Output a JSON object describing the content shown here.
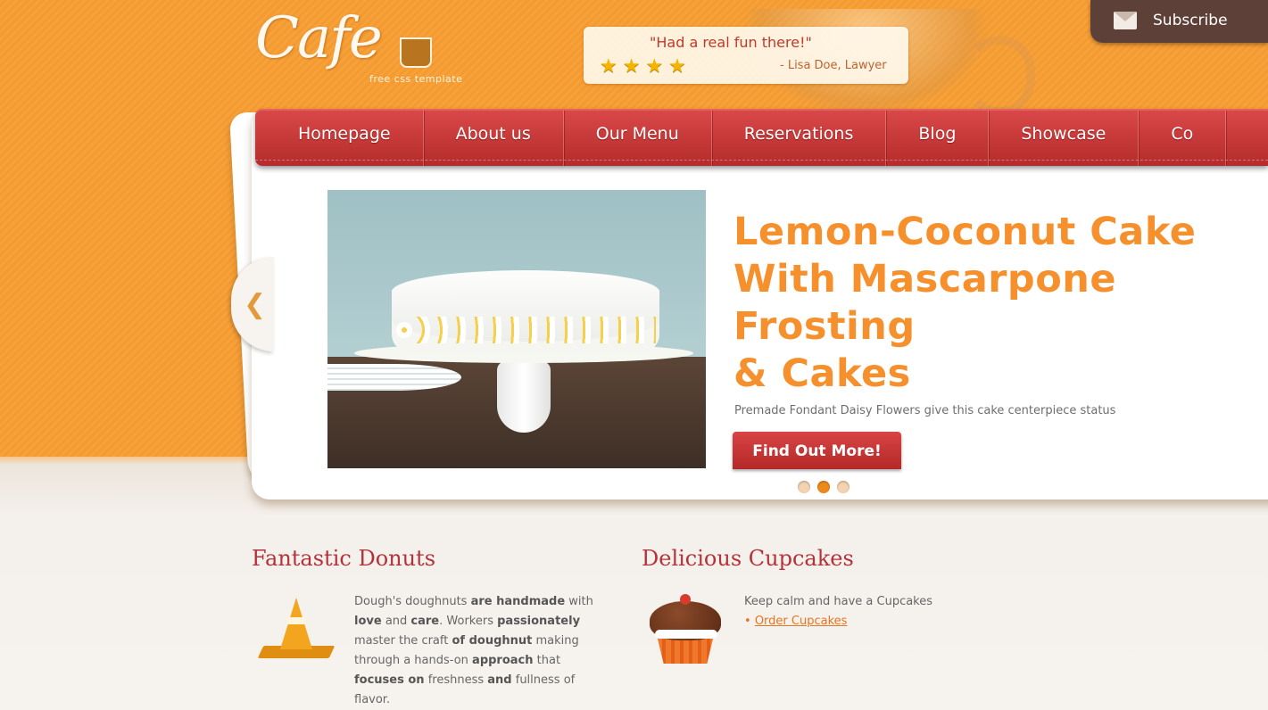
{
  "logo": {
    "text": "Cafe",
    "subtitle": "free css template"
  },
  "testimonial": {
    "quote": "\"Had a real fun there!\"",
    "rating": 4,
    "rating_max": 4,
    "author": "- Lisa Doe, Lawyer"
  },
  "subscribe": {
    "label": "Subscribe",
    "icon": "envelope-icon"
  },
  "nav": {
    "items": [
      "Homepage",
      "About us",
      "Our Menu",
      "Reservations",
      "Blog",
      "Showcase",
      "Co"
    ]
  },
  "slider": {
    "title": "Lemon-Coconut Cake\nWith Mascarpone\nFrosting\n& Cakes",
    "description": "Premade Fondant Daisy Flowers give this cake centerpiece status",
    "button_label": "Find Out More!",
    "prev_icon": "chevron-left-icon",
    "dots_count": 3,
    "active_dot": 1
  },
  "features": {
    "donuts": {
      "title": "Fantastic Donuts",
      "icon": "traffic-cone-icon",
      "text_parts": [
        {
          "t": "Dough's doughnuts ",
          "b": false
        },
        {
          "t": "are handmade",
          "b": true
        },
        {
          "t": " with ",
          "b": false
        },
        {
          "t": "love",
          "b": true
        },
        {
          "t": " and ",
          "b": false
        },
        {
          "t": "care",
          "b": true
        },
        {
          "t": ". Workers ",
          "b": false
        },
        {
          "t": "passionately",
          "b": true
        },
        {
          "t": " master the craft ",
          "b": false
        },
        {
          "t": "of doughnut",
          "b": true
        },
        {
          "t": " making through a hands-on ",
          "b": false
        },
        {
          "t": "approach",
          "b": true
        },
        {
          "t": " that ",
          "b": false
        },
        {
          "t": "focuses on",
          "b": true
        },
        {
          "t": " freshness ",
          "b": false
        },
        {
          "t": "and",
          "b": true
        },
        {
          "t": " fullness of flavor.",
          "b": false
        }
      ]
    },
    "cupcakes": {
      "title": "Delicious Cupcakes",
      "icon": "cupcake-icon",
      "text": "Keep calm and have a Cupcakes",
      "link_bullet": "•",
      "link": "Order Cupcakes"
    }
  },
  "colors": {
    "orange_bg": "#f7a13a",
    "nav_red": "#c83838",
    "title_orange": "#f5902d",
    "heading_red": "#b5323a",
    "subscribe_brown": "#5d4037"
  }
}
